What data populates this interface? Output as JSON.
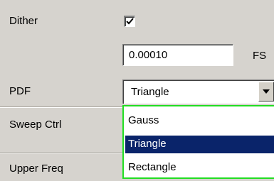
{
  "fields": {
    "dither_label": "Dither",
    "dither_checked": true,
    "value": "0.00010",
    "value_unit": "FS",
    "pdf_label": "PDF",
    "pdf_selected": "Triangle",
    "sweep_label": "Sweep Ctrl",
    "upper_freq_label": "Upper Freq"
  },
  "dropdown": {
    "options": [
      "Gauss",
      "Triangle",
      "Rectangle"
    ],
    "highlighted": "Triangle"
  },
  "colors": {
    "background": "#d6d3ce",
    "selection": "#0a246a",
    "dropdown_border": "#22dd22"
  },
  "icons": {
    "checkbox": "check-icon",
    "combo_button": "chevron-down-icon"
  }
}
